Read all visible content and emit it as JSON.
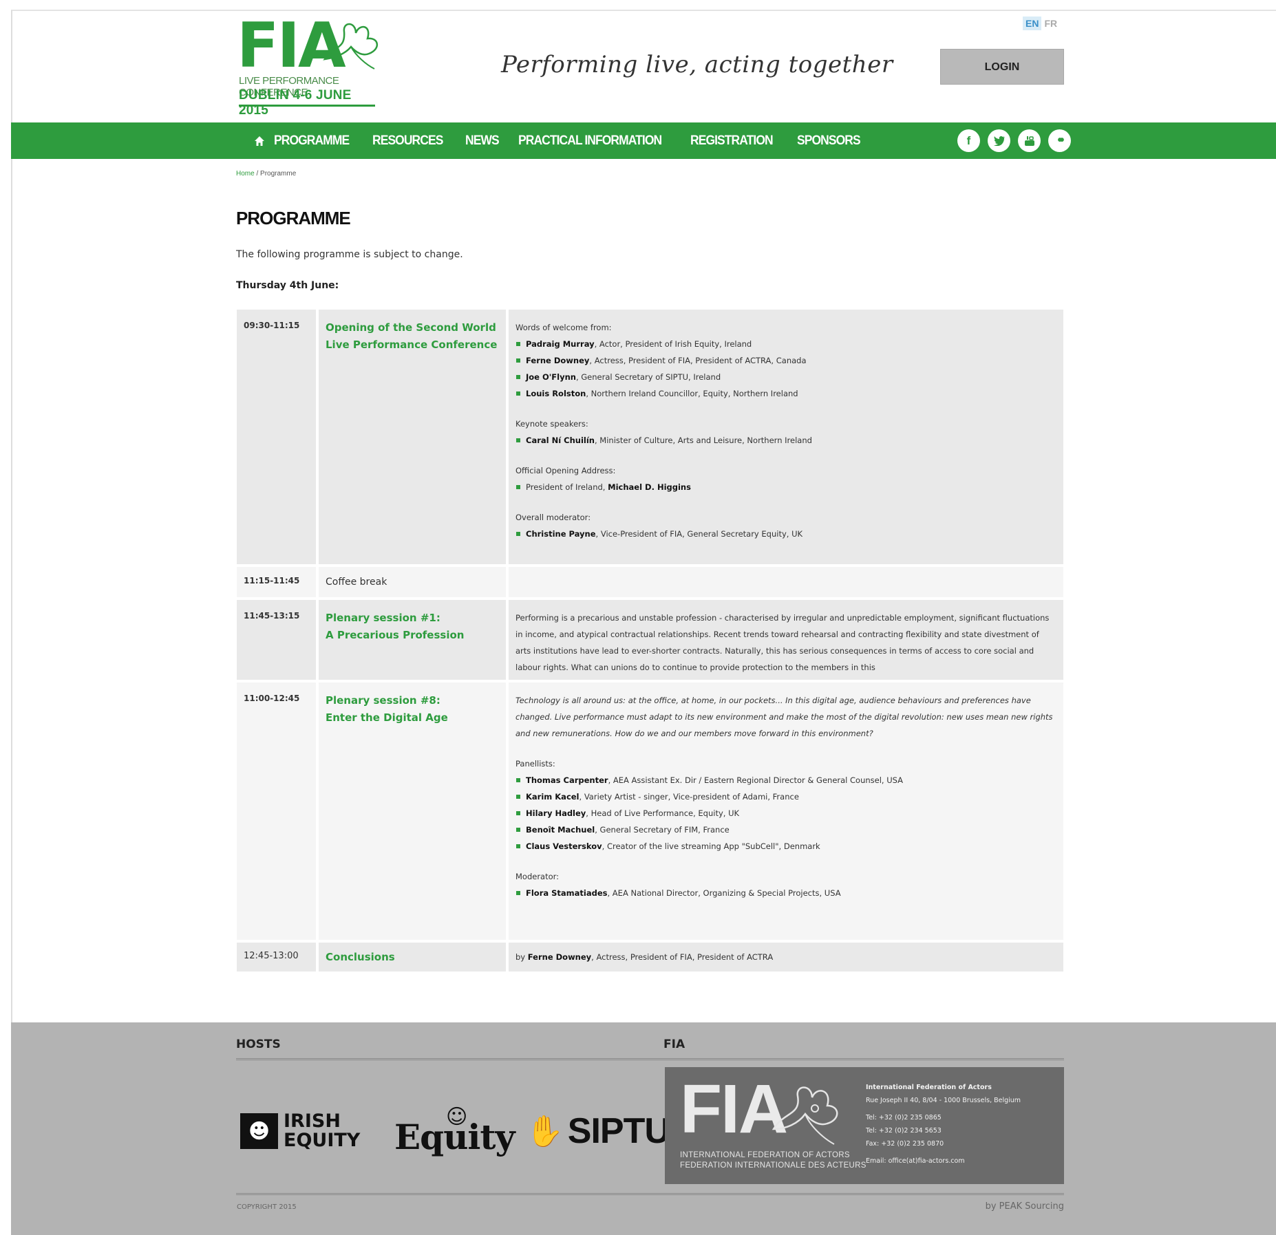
{
  "header": {
    "logo": {
      "title": "FIA",
      "subtitle": "LIVE PERFORMANCE CONFERENCE",
      "dates": "DUBLIN 4-6 JUNE 2015"
    },
    "tagline": "Performing live, acting together",
    "lang": {
      "en": "EN",
      "fr": "FR"
    },
    "login_label": "LOGIN"
  },
  "nav": {
    "items": [
      "PROGRAMME",
      "RESOURCES",
      "NEWS",
      "PRACTICAL INFORMATION",
      "REGISTRATION",
      "SPONSORS"
    ],
    "social": {
      "facebook": "f",
      "twitter": "t",
      "youtube": "You",
      "flickr": "••"
    }
  },
  "breadcrumb": {
    "home": "Home",
    "sep": " / ",
    "current": "Programme"
  },
  "page": {
    "title": "PROGRAMME",
    "intro": "The following programme is subject to change.",
    "day": "Thursday 4th June:"
  },
  "programme": [
    {
      "time": "09:30-11:15",
      "title": "Opening of the Second World Live Performance Conference",
      "welcome_label": "Words of welcome from:",
      "welcome": [
        {
          "name": "Padraig Murray",
          "role": ", Actor, President of Irish Equity, Ireland"
        },
        {
          "name": "Ferne Downey",
          "role": ", Actress, President of FIA, President of ACTRA, Canada"
        },
        {
          "name": "Joe O'Flynn",
          "role": ", General Secretary of SIPTU, Ireland"
        },
        {
          "name": "Louis Rolston",
          "role": ", Northern Ireland Councillor, Equity, Northern Ireland"
        }
      ],
      "keynote_label": "Keynote speakers:",
      "keynote": [
        {
          "name": "Caral Ní Chuilín",
          "role": ", Minister of Culture, Arts and Leisure, Northern Ireland"
        }
      ],
      "opening_label": "Official Opening Address:",
      "opening": [
        {
          "prefix": "President of Ireland, ",
          "name": "Michael D. Higgins"
        }
      ],
      "moderator_label": "Overall moderator:",
      "moderator": [
        {
          "name": "Christine Payne",
          "role": ", Vice-President of FIA, General Secretary Equity, UK"
        }
      ]
    },
    {
      "time": "11:15-11:45",
      "title": "Coffee break"
    },
    {
      "time": "11:45-13:15",
      "title_line1": "Plenary session #1:",
      "title_line2": "A Precarious Profession",
      "desc": "Performing is a precarious and unstable profession - characterised by irregular and unpredictable employment, significant fluctuations in income, and atypical contractual relationships. Recent trends toward rehearsal and contracting flexibility and state divestment of arts institutions have lead to ever-shorter contracts. Naturally, this has serious consequences in terms of access to core social and labour rights. What can unions do to continue to provide protection to the members in this"
    },
    {
      "time": "11:00-12:45",
      "title_line1": "Plenary session #8:",
      "title_line2": "Enter the Digital Age",
      "desc": "Technology is all around us: at the office, at home, in our pockets... In this digital age, audience behaviours and preferences have changed. Live performance must adapt to its new environment and make the most of the digital revolution: new uses mean new rights and new remunerations. How do we and our members move forward in this environment?",
      "panellists_label": "Panellists:",
      "panellists": [
        {
          "name": "Thomas Carpenter",
          "role": ", AEA Assistant Ex. Dir / Eastern Regional Director & General Counsel, USA"
        },
        {
          "name": "Karim Kacel",
          "role": ", Variety Artist - singer, Vice-president of Adami, France"
        },
        {
          "name": "Hilary Hadley",
          "role": ", Head of Live Performance, Equity, UK"
        },
        {
          "name": "Benoît Machuel",
          "role": ", General Secretary of FIM, France"
        },
        {
          "name": "Claus Vesterskov",
          "role": ", Creator of the live streaming App \"SubCell\", Denmark"
        }
      ],
      "moderator_label": "Moderator:",
      "moderator": [
        {
          "name": "Flora Stamatiades",
          "role": ", AEA National Director, Organizing & Special Projects, USA"
        }
      ]
    },
    {
      "time": "12:45-13:00",
      "title": "Conclusions",
      "prefix": "by ",
      "name": "Ferne Downey",
      "role": ", Actress, President of FIA, President of ACTRA"
    }
  ],
  "footer": {
    "hosts_heading": "HOSTS",
    "fia_heading": "FIA",
    "irish_equity": "IRISH\nEQUITY",
    "equity": "Equity",
    "siptu": "SIPTU",
    "fia_logo": "FIA",
    "fia_logo_line1": "INTERNATIONAL FEDERATION OF ACTORS",
    "fia_logo_line2": "FEDERATION INTERNATIONALE DES ACTEURS",
    "contact": {
      "name": "International Federation of Actors",
      "address": "Rue Joseph II 40, 8/04 - 1000 Brussels, Belgium",
      "tel1": "Tel: +32 (0)2 235 0865",
      "tel2": "Tel: +32 (0)2 234 5653",
      "fax": "Fax: +32 (0)2 235 0870",
      "email": "Email: office(at)fia-actors.com"
    },
    "copyright": "COPYRIGHT 2015",
    "byline": "by PEAK Sourcing"
  }
}
